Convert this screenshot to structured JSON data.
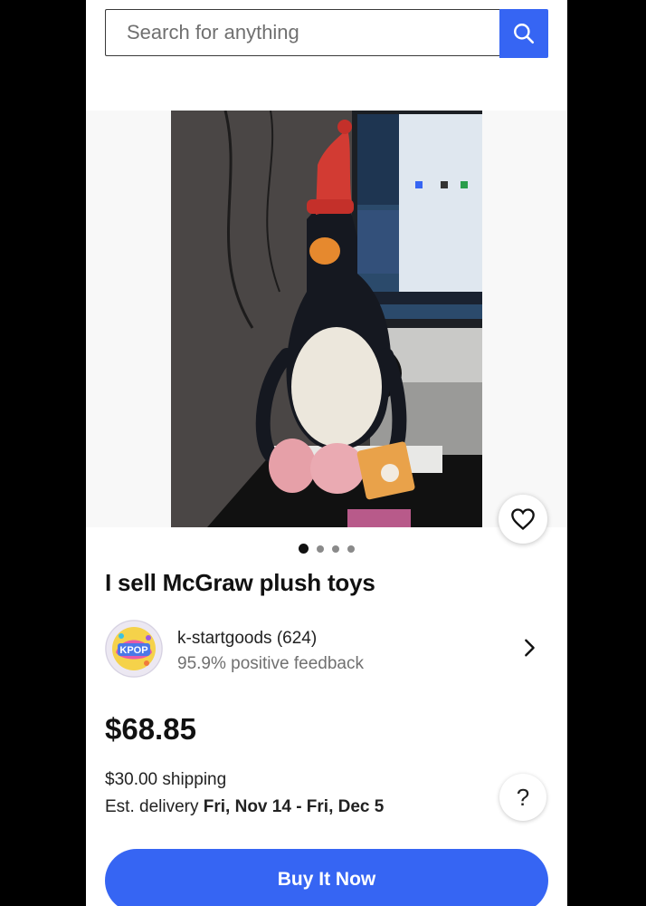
{
  "search": {
    "placeholder": "Search for anything",
    "button_icon": "search-icon"
  },
  "gallery": {
    "image_count": 4,
    "active_index": 0,
    "favorite_icon": "heart-outline-icon"
  },
  "listing": {
    "title": "I sell McGraw plush toys",
    "price": "$68.85",
    "shipping": "$30.00 shipping",
    "delivery_prefix": "Est. delivery ",
    "delivery_dates": "Fri, Nov 14 - Fri, Dec 5"
  },
  "seller": {
    "name": "k-startgoods (624)",
    "feedback": "95.9% positive feedback",
    "logo_text": "KPOP"
  },
  "help_label": "?",
  "buy_label": "Buy It Now",
  "colors": {
    "accent": "#3665f3",
    "text": "#111111",
    "muted": "#707070"
  }
}
